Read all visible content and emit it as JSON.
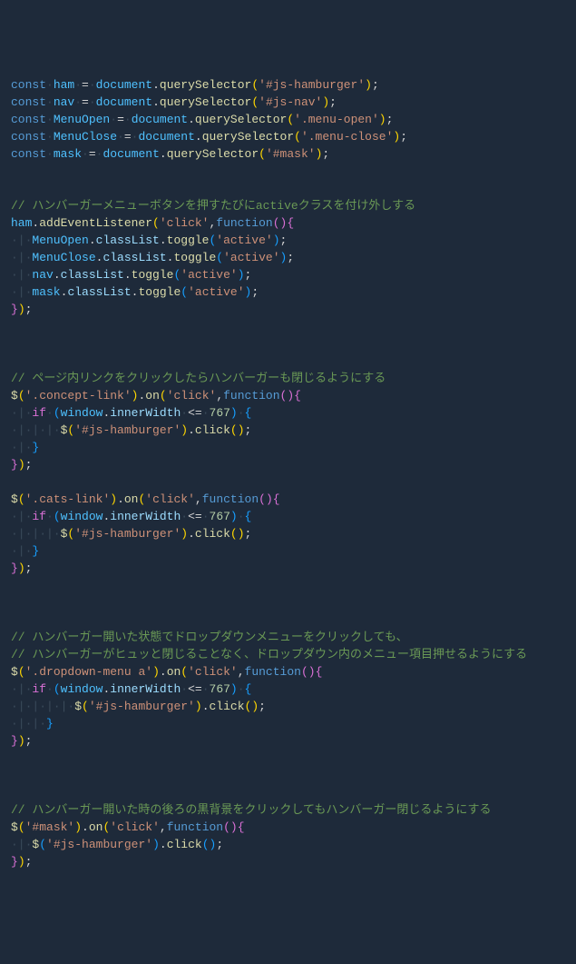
{
  "code": {
    "declarations": [
      {
        "name": "ham",
        "selector": "'#js-hamburger'"
      },
      {
        "name": "nav",
        "selector": "'#js-nav'"
      },
      {
        "name": "MenuOpen",
        "selector": "'.menu-open'"
      },
      {
        "name": "MenuClose",
        "selector": "'.menu-close'"
      },
      {
        "name": "mask",
        "selector": "'#mask'"
      }
    ],
    "section1": {
      "comment": "// ハンバーガーメニューボタンを押すたびにactiveクラスを付け外しする",
      "listener_target": "ham",
      "listener_method": "addEventListener",
      "event": "'click'",
      "body": [
        {
          "obj": "MenuOpen",
          "chain": "classList",
          "method": "toggle",
          "arg": "'active'"
        },
        {
          "obj": "MenuClose",
          "chain": "classList",
          "method": "toggle",
          "arg": "'active'"
        },
        {
          "obj": "nav",
          "chain": "classList",
          "method": "toggle",
          "arg": "'active'"
        },
        {
          "obj": "mask",
          "chain": "classList",
          "method": "toggle",
          "arg": "'active'"
        }
      ]
    },
    "section2": {
      "comment": "// ページ内リンクをクリックしたらハンバーガーも閉じるようにする",
      "selector": "'.concept-link'",
      "event": "'click'",
      "cond_left": "window.innerWidth",
      "cond_op": "<=",
      "cond_right": "767",
      "inner_selector": "'#js-hamburger'",
      "inner_method": "click"
    },
    "section3": {
      "selector": "'.cats-link'",
      "event": "'click'",
      "cond_left": "window.innerWidth",
      "cond_op": "<=",
      "cond_right": "767",
      "inner_selector": "'#js-hamburger'",
      "inner_method": "click"
    },
    "section4": {
      "comment1": "// ハンバーガー開いた状態でドロップダウンメニューをクリックしても、",
      "comment2": "// ハンバーガーがヒュッと閉じることなく、ドロップダウン内のメニュー項目押せるようにする",
      "selector": "'.dropdown-menu a'",
      "event": "'click'",
      "cond_left": "window.innerWidth",
      "cond_op": "<=",
      "cond_right": "767",
      "inner_selector": "'#js-hamburger'",
      "inner_method": "click"
    },
    "section5": {
      "comment": "// ハンバーガー開いた時の後ろの黒背景をクリックしてもハンバーガー閉じるようにする",
      "selector": "'#mask'",
      "event": "'click'",
      "inner_selector": "'#js-hamburger'",
      "inner_method": "click"
    }
  }
}
